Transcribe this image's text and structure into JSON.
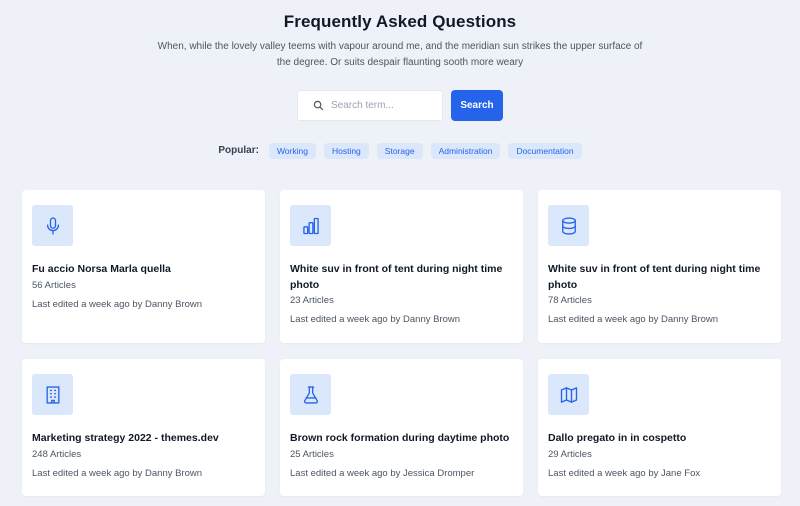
{
  "header": {
    "title": "Frequently Asked Questions",
    "subtitle": "When, while the lovely valley teems with vapour around me, and the meridian sun strikes the upper surface of the degree. Or suits despair flaunting sooth more weary"
  },
  "search": {
    "placeholder": "Search term...",
    "button_label": "Search",
    "icon": "search-icon"
  },
  "popular": {
    "label": "Popular:",
    "tags": [
      "Working",
      "Hosting",
      "Storage",
      "Administration",
      "Documentation"
    ]
  },
  "colors": {
    "accent": "#2563eb",
    "tag_bg": "#dbe7fb",
    "page_bg": "#eef2f8"
  },
  "cards": [
    {
      "icon": "microphone-icon",
      "title": "Fu accio Norsa Marla quella",
      "count": "56 Articles",
      "meta": "Last edited a week ago by Danny Brown"
    },
    {
      "icon": "bar-chart-icon",
      "title": "White suv in front of tent during night time photo",
      "count": "23 Articles",
      "meta": "Last edited a week ago by Danny Brown"
    },
    {
      "icon": "database-icon",
      "title": "White suv in front of tent during night time photo",
      "count": "78 Articles",
      "meta": "Last edited a week ago by Danny Brown"
    },
    {
      "icon": "building-icon",
      "title": "Marketing strategy 2022 - themes.dev",
      "count": "248 Articles",
      "meta": "Last edited a week ago by Danny Brown"
    },
    {
      "icon": "flask-icon",
      "title": "Brown rock formation during daytime photo",
      "count": "25 Articles",
      "meta": "Last edited a week ago by Jessica Dromper"
    },
    {
      "icon": "map-icon",
      "title": "Dallo pregato in in cospetto",
      "count": "29 Articles",
      "meta": "Last edited a week ago by Jane Fox"
    }
  ]
}
